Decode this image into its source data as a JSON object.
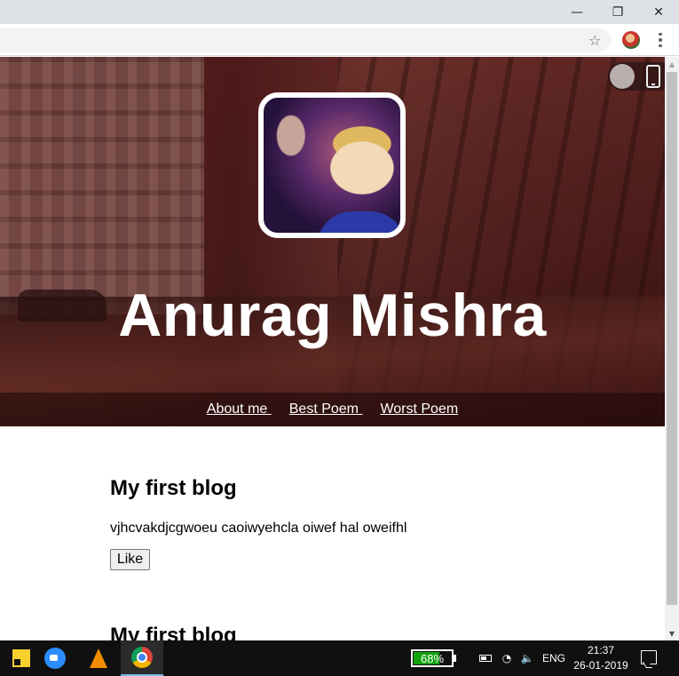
{
  "window": {
    "minimize_glyph": "—",
    "maximize_glyph": "❐",
    "close_glyph": "✕"
  },
  "toolbar": {
    "star_glyph": "☆"
  },
  "hero": {
    "title": "Anurag Mishra",
    "nav": [
      {
        "label": "About me "
      },
      {
        "label": "Best Poem "
      },
      {
        "label": "Worst Poem"
      }
    ],
    "toggle_state": "off"
  },
  "posts": [
    {
      "title": "My first blog",
      "body": "vjhcvakdjcgwoeu caoiwyehcla oiwef hal oweifhl",
      "like_label": "Like"
    },
    {
      "title": "My first blog"
    }
  ],
  "taskbar": {
    "apps": [
      "sticky-notes-icon",
      "zoom-icon",
      "vlc-icon",
      "chrome-icon"
    ],
    "active_app": "chrome",
    "battery_percent": "68%",
    "battery_level": 0.68,
    "language": "ENG",
    "time": "21:37",
    "date": "26-01-2019"
  },
  "colors": {
    "battery_green": "#13a10e",
    "taskbar_bg": "#101010",
    "titlebar_bg": "#dee1e6"
  }
}
